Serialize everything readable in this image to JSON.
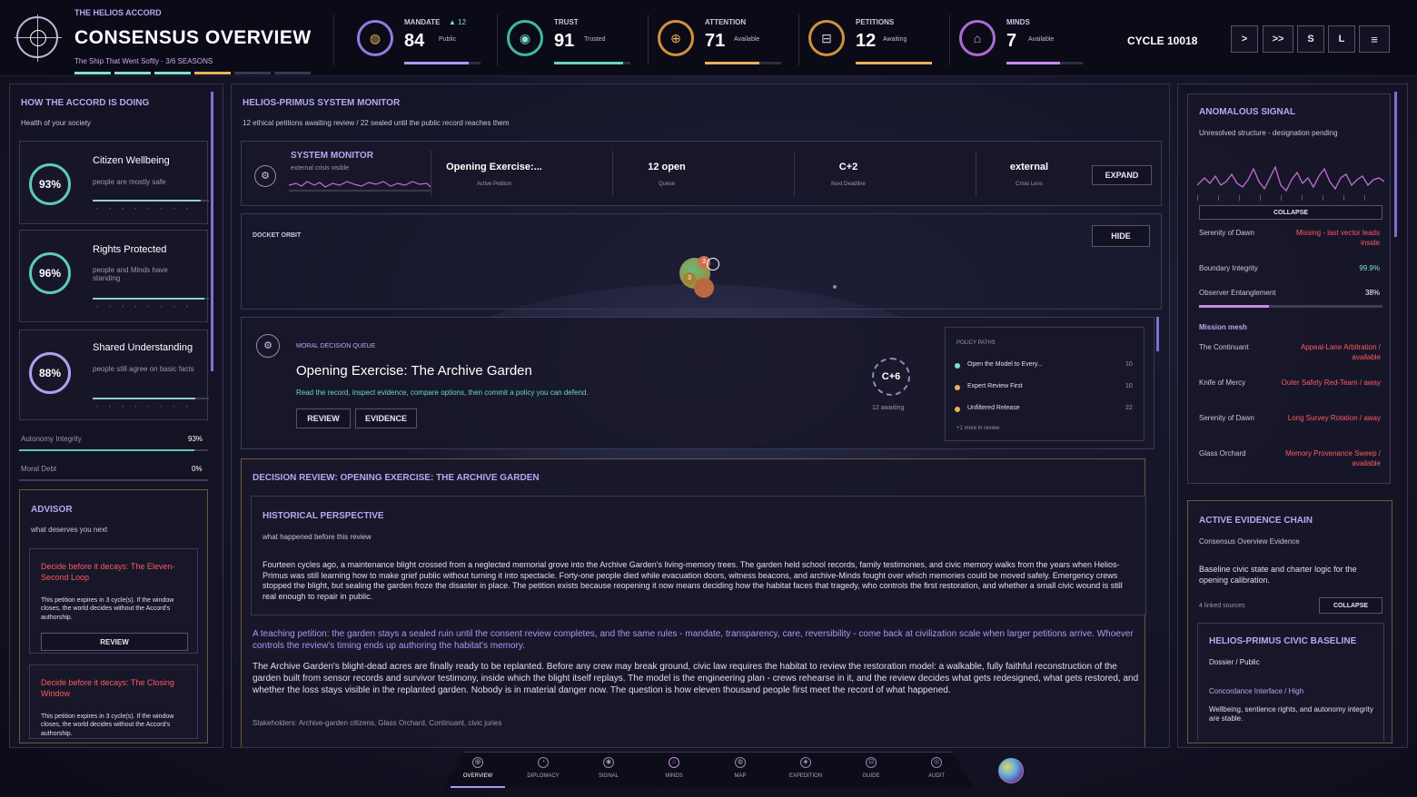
{
  "header": {
    "org": "THE HELIOS ACCORD",
    "title": "CONSENSUS OVERVIEW",
    "subtitle": "The Ship That Went Softly · 3/6 SEASONS",
    "cycle": "CYCLE 10018",
    "controls": [
      ">",
      ">>",
      "S",
      "L",
      "≡"
    ],
    "stats": [
      {
        "label": "MANDATE",
        "delta": "▲ 12",
        "value": "84",
        "sub": "Public",
        "fill": 0.84,
        "color": "#a99af0",
        "icon": "mandate-icon"
      },
      {
        "label": "TRUST",
        "value": "91",
        "sub": "Trusted",
        "fill": 0.91,
        "color": "#6ad6c4",
        "icon": "trust-icon"
      },
      {
        "label": "ATTENTION",
        "value": "71",
        "sub": "Available",
        "fill": 0.71,
        "color": "#e8b25c",
        "icon": "attention-icon"
      },
      {
        "label": "PETITIONS",
        "value": "12",
        "sub": "Awaiting",
        "fill": 1.0,
        "color": "#e8b25c",
        "icon": "petitions-icon"
      },
      {
        "label": "MINDS",
        "value": "7",
        "sub": "Available",
        "fill": 0.7,
        "color": "#c98ae8",
        "icon": "minds-icon"
      }
    ]
  },
  "left": {
    "title": "HOW THE ACCORD IS DOING",
    "subtitle": "Health of your society",
    "metrics": [
      {
        "name": "Citizen Wellbeing",
        "value": "93%",
        "desc": "people are mostly safe",
        "fill": 0.93
      },
      {
        "name": "Rights Protected",
        "value": "96%",
        "desc": "people and Minds have standing",
        "fill": 0.96
      },
      {
        "name": "Shared Understanding",
        "value": "88%",
        "desc": "people still agree on basic facts",
        "fill": 0.88
      }
    ],
    "autonomy": {
      "label": "Autonomy Integrity",
      "value": "93%",
      "fill": 0.93
    },
    "debt": {
      "label": "Moral Debt",
      "value": "0%",
      "fill": 0
    },
    "advisor": {
      "title": "ADVISOR",
      "subtitle": "what deserves you next",
      "items": [
        {
          "title": "Decide before it decays: The Eleven-Second Loop",
          "body": "This petition expires in 3 cycle(s). If the window closes, the world decides without the Accord's authorship.",
          "button": "REVIEW"
        },
        {
          "title": "Decide before it decays: The Closing Window",
          "body": "This petition expires in 3 cycle(s). If the window closes, the world decides without the Accord's authorship."
        }
      ]
    }
  },
  "center": {
    "title": "HELIOS-PRIMUS SYSTEM MONITOR",
    "subtitle": "12 ethical petitions awaiting review / 22 sealed until the public record reaches them",
    "monitor": {
      "title": "SYSTEM MONITOR",
      "sub": "external crisis visible",
      "cells": [
        {
          "value": "Opening Exercise:...",
          "label": "Active Petition"
        },
        {
          "value": "12 open",
          "label": "Queue"
        },
        {
          "value": "C+2",
          "label": "Next Deadline"
        },
        {
          "value": "external",
          "label": "Crisis Lens"
        }
      ],
      "expand": "EXPAND"
    },
    "orbit": {
      "title": "DOCKET ORBIT",
      "hide": "HIDE",
      "badges": [
        "3",
        "3"
      ]
    },
    "queue": {
      "kicker": "MORAL DECISION QUEUE",
      "title": "Opening Exercise: The Archive Garden",
      "instruction": "Read the record, inspect evidence, compare options, then commit a policy you can defend.",
      "review": "REVIEW",
      "evidence": "EVIDENCE",
      "clock": "C+6",
      "awaiting": "12 awaiting",
      "policy_title": "POLICY PATHS",
      "policies": [
        {
          "label": "Open the Model to Every...",
          "value": "10",
          "color": "#7fe0d2"
        },
        {
          "label": "Expert Review First",
          "value": "10",
          "color": "#e8b25c"
        },
        {
          "label": "Unfiltered Release",
          "value": "22",
          "color": "#e8b25c"
        }
      ],
      "more": "+1 more in review"
    },
    "review": {
      "title": "DECISION REVIEW: OPENING EXERCISE: THE ARCHIVE GARDEN",
      "history_title": "HISTORICAL PERSPECTIVE",
      "history_sub": "what happened before this review",
      "history_body": "Fourteen cycles ago, a maintenance blight crossed from a neglected memorial grove into the Archive Garden's living-memory trees. The garden held school records, family testimonies, and civic memory walks from the years when Helios-Primus was still learning how to make grief public without turning it into spectacle. Forty-one people died while evacuation doors, witness beacons, and archive-Minds fought over which memories could be moved safely. Emergency crews stopped the blight, but sealing the garden froze the disaster in place. The petition exists because reopening it now means deciding how the habitat faces that tragedy, who controls the first restoration, and whether a small civic wound is still real enough to repair in public.",
      "teaching": "A teaching petition: the garden stays a sealed ruin until the consent review completes, and the same rules - mandate, transparency, care, reversibility - come back at civilization scale when larger petitions arrive. Whoever controls the review's timing ends up authoring the habitat's memory.",
      "body": "The Archive Garden's blight-dead acres are finally ready to be replanted. Before any crew may break ground, civic law requires the habitat to review the restoration model: a walkable, fully faithful reconstruction of the garden built from sensor records and survivor testimony, inside which the blight itself replays. The model is the engineering plan - crews rehearse in it, and the review decides what gets redesigned, what gets restored, and whether the loss stays visible in the replanted garden. Nobody is in material danger now. The question is how eleven thousand people first meet the record of what happened.",
      "stakeholders": "Stakeholders: Archive-garden citizens, Glass Orchard, Continuant, civic juries"
    }
  },
  "right": {
    "signal": {
      "title": "ANOMALOUS SIGNAL",
      "subtitle": "Unresolved structure - designation pending",
      "collapse": "COLLAPSE",
      "rows": [
        {
          "label": "Serenity of Dawn",
          "value": "Missing - last vector leads inside",
          "color": "#ff5a5f"
        },
        {
          "label": "Boundary Integrity",
          "value": "99.9%",
          "color": "#7fe0d2"
        },
        {
          "label": "Observer Entanglement",
          "value": "38%",
          "color": "#e8e6f2"
        }
      ],
      "observer_fill": 0.38,
      "mesh_title": "Mission mesh",
      "mesh": [
        {
          "label": "The Continuant",
          "value": "Appeal-Lane Arbitration / available"
        },
        {
          "label": "Knife of Mercy",
          "value": "Outer Safety Red-Team / away"
        },
        {
          "label": "Serenity of Dawn",
          "value": "Long Survey Rotation / away"
        },
        {
          "label": "Glass Orchard",
          "value": "Memory Provenance Sweep / available"
        }
      ]
    },
    "evidence": {
      "title": "ACTIVE EVIDENCE CHAIN",
      "subtitle": "Consensus Overview Evidence",
      "body": "Baseline civic state and charter logic for the opening calibration.",
      "sources": "4 linked sources",
      "collapse": "COLLAPSE",
      "baseline_title": "HELIOS-PRIMUS CIVIC BASELINE",
      "baseline_sub": "Dossier / Public",
      "interface": "Concordance Interface / High",
      "baseline_body": "Wellbeing, sentience rights, and autonomy integrity are stable."
    }
  },
  "nav": [
    "OVERVIEW",
    "DIPLOMACY",
    "SIGNAL",
    "MINDS",
    "MAP",
    "EXPEDITION",
    "GUIDE",
    "AUDIT"
  ]
}
